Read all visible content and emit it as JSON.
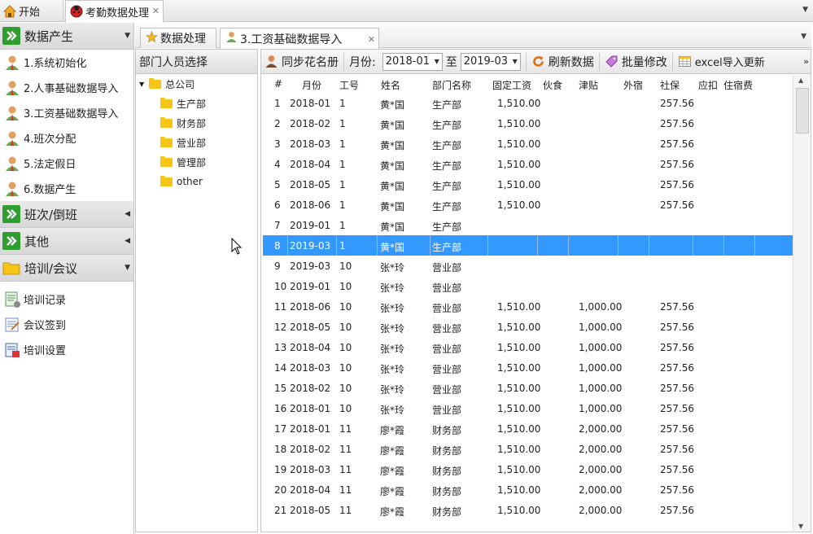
{
  "top_tabs": {
    "home": "开始",
    "active": "考勤数据处理"
  },
  "sidebar": {
    "group1": "数据产生",
    "items1": [
      "1.系统初始化",
      "2.人事基础数据导入",
      "3.工资基础数据导入",
      "4.班次分配",
      "5.法定假日",
      "6.数据产生"
    ],
    "group2": "班次/倒班",
    "group3": "其他",
    "group4": "培训/会议",
    "items4": [
      "培训记录",
      "会议签到",
      "培训设置"
    ]
  },
  "second_tabs": {
    "t1": "数据处理",
    "t2": "3.工资基础数据导入"
  },
  "dept": {
    "header": "部门人员选择",
    "root": "总公司",
    "children": [
      "生产部",
      "财务部",
      "营业部",
      "管理部",
      "other"
    ]
  },
  "toolbar": {
    "sync": "同步花名册",
    "month_label": "月份:",
    "month_from": "2018-01",
    "to_label": "至",
    "month_to": "2019-03",
    "refresh": "刷新数据",
    "batch": "批量修改",
    "excel": "excel导入更新"
  },
  "table": {
    "columns": [
      "#",
      "月份",
      "工号",
      "姓名",
      "部门名称",
      "固定工资",
      "伙食",
      "津贴",
      "外宿",
      "社保",
      "应扣",
      "住宿费"
    ],
    "selected_index": 7,
    "rows": [
      [
        "1",
        "2018-01",
        "1",
        "黄*国",
        "生产部",
        "1,510.00",
        "",
        "",
        "",
        "257.56",
        "",
        ""
      ],
      [
        "2",
        "2018-02",
        "1",
        "黄*国",
        "生产部",
        "1,510.00",
        "",
        "",
        "",
        "257.56",
        "",
        ""
      ],
      [
        "3",
        "2018-03",
        "1",
        "黄*国",
        "生产部",
        "1,510.00",
        "",
        "",
        "",
        "257.56",
        "",
        ""
      ],
      [
        "4",
        "2018-04",
        "1",
        "黄*国",
        "生产部",
        "1,510.00",
        "",
        "",
        "",
        "257.56",
        "",
        ""
      ],
      [
        "5",
        "2018-05",
        "1",
        "黄*国",
        "生产部",
        "1,510.00",
        "",
        "",
        "",
        "257.56",
        "",
        ""
      ],
      [
        "6",
        "2018-06",
        "1",
        "黄*国",
        "生产部",
        "1,510.00",
        "",
        "",
        "",
        "257.56",
        "",
        ""
      ],
      [
        "7",
        "2019-01",
        "1",
        "黄*国",
        "生产部",
        "",
        "",
        "",
        "",
        "",
        "",
        ""
      ],
      [
        "8",
        "2019-03",
        "1",
        "黄*国",
        "生产部",
        "",
        "",
        "",
        "",
        "",
        "",
        ""
      ],
      [
        "9",
        "2019-03",
        "10",
        "张*玲",
        "营业部",
        "",
        "",
        "",
        "",
        "",
        "",
        ""
      ],
      [
        "10",
        "2019-01",
        "10",
        "张*玲",
        "营业部",
        "",
        "",
        "",
        "",
        "",
        "",
        ""
      ],
      [
        "11",
        "2018-06",
        "10",
        "张*玲",
        "营业部",
        "1,510.00",
        "",
        "1,000.00",
        "",
        "257.56",
        "",
        ""
      ],
      [
        "12",
        "2018-05",
        "10",
        "张*玲",
        "营业部",
        "1,510.00",
        "",
        "1,000.00",
        "",
        "257.56",
        "",
        ""
      ],
      [
        "13",
        "2018-04",
        "10",
        "张*玲",
        "营业部",
        "1,510.00",
        "",
        "1,000.00",
        "",
        "257.56",
        "",
        ""
      ],
      [
        "14",
        "2018-03",
        "10",
        "张*玲",
        "营业部",
        "1,510.00",
        "",
        "1,000.00",
        "",
        "257.56",
        "",
        ""
      ],
      [
        "15",
        "2018-02",
        "10",
        "张*玲",
        "营业部",
        "1,510.00",
        "",
        "1,000.00",
        "",
        "257.56",
        "",
        ""
      ],
      [
        "16",
        "2018-01",
        "10",
        "张*玲",
        "营业部",
        "1,510.00",
        "",
        "1,000.00",
        "",
        "257.56",
        "",
        ""
      ],
      [
        "17",
        "2018-01",
        "11",
        "廖*霞",
        "财务部",
        "1,510.00",
        "",
        "2,000.00",
        "",
        "257.56",
        "",
        ""
      ],
      [
        "18",
        "2018-02",
        "11",
        "廖*霞",
        "财务部",
        "1,510.00",
        "",
        "2,000.00",
        "",
        "257.56",
        "",
        ""
      ],
      [
        "19",
        "2018-03",
        "11",
        "廖*霞",
        "财务部",
        "1,510.00",
        "",
        "2,000.00",
        "",
        "257.56",
        "",
        ""
      ],
      [
        "20",
        "2018-04",
        "11",
        "廖*霞",
        "财务部",
        "1,510.00",
        "",
        "2,000.00",
        "",
        "257.56",
        "",
        ""
      ],
      [
        "21",
        "2018-05",
        "11",
        "廖*霞",
        "财务部",
        "1,510.00",
        "",
        "2,000.00",
        "",
        "257.56",
        "",
        ""
      ]
    ]
  }
}
